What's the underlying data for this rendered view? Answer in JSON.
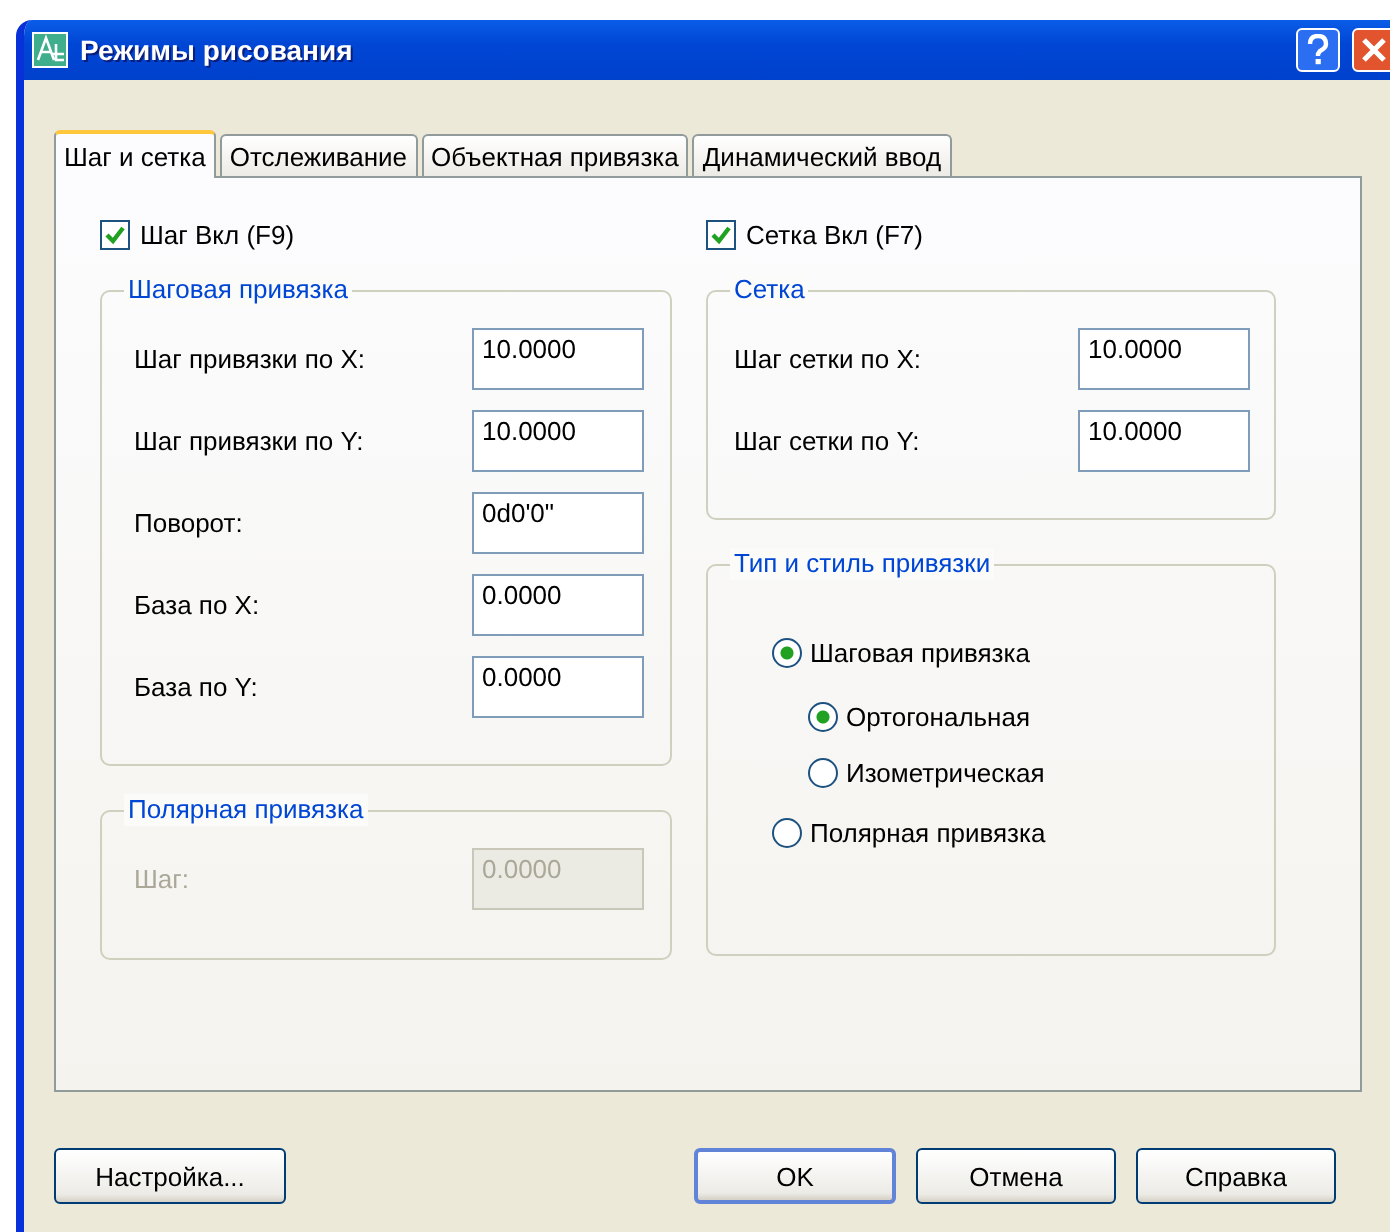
{
  "window": {
    "title": "Режимы рисования"
  },
  "tabs": [
    {
      "label": "Шаг и сетка",
      "selected": true
    },
    {
      "label": "Отслеживание",
      "selected": false
    },
    {
      "label": "Объектная привязка",
      "selected": false
    },
    {
      "label": "Динамический ввод",
      "selected": false
    }
  ],
  "snap_checkbox": {
    "label": "Шаг Вкл (F9)",
    "checked": true
  },
  "snap_group": {
    "title": "Шаговая привязка",
    "disabled": false,
    "fields": [
      {
        "label": "Шаг привязки по X:",
        "value": "10.0000"
      },
      {
        "label": "Шаг привязки по Y:",
        "value": "10.0000"
      },
      {
        "label": "Поворот:",
        "value": "0d0'0\""
      },
      {
        "label": "База по X:",
        "value": "0.0000"
      },
      {
        "label": "База по Y:",
        "value": "0.0000"
      }
    ]
  },
  "polar_group": {
    "title": "Полярная привязка",
    "disabled": true,
    "fields": [
      {
        "label": "Шаг:",
        "value": "0.0000"
      }
    ]
  },
  "grid_checkbox": {
    "label": "Сетка Вкл (F7)",
    "checked": true
  },
  "grid_group": {
    "title": "Сетка",
    "disabled": false,
    "fields": [
      {
        "label": "Шаг сетки по X:",
        "value": "10.0000"
      },
      {
        "label": "Шаг сетки по Y:",
        "value": "10.0000"
      }
    ]
  },
  "style_group": {
    "title": "Тип и стиль привязки",
    "options": [
      {
        "label": "Шаговая привязка",
        "selected": true,
        "children": [
          {
            "label": "Ортогональная",
            "selected": true
          },
          {
            "label": "Изометрическая",
            "selected": false
          }
        ]
      },
      {
        "label": "Полярная привязка",
        "selected": false
      }
    ]
  },
  "buttons": [
    {
      "label": "Настройка...",
      "default": false
    },
    {
      "label": "OK",
      "default": true
    },
    {
      "label": "Отмена",
      "default": false
    },
    {
      "label": "Справка",
      "default": false
    }
  ]
}
